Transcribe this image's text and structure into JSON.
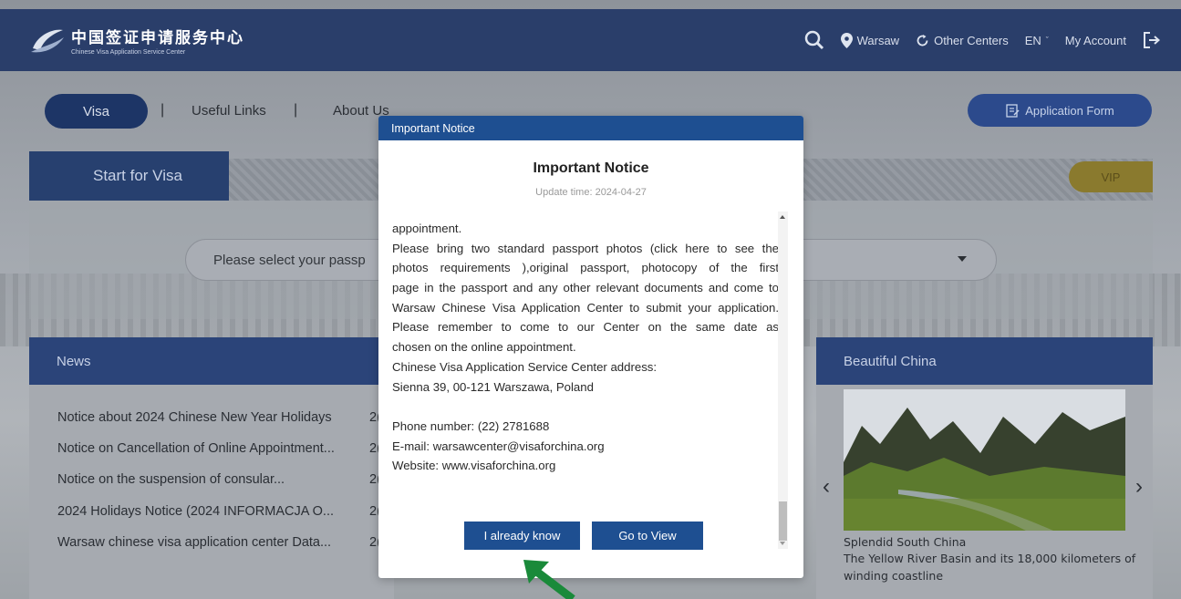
{
  "header": {
    "logo_cn": "中国签证申请服务中心",
    "logo_en": "Chinese Visa Application Service Center",
    "location": "Warsaw",
    "other_centers": "Other Centers",
    "language": "EN",
    "my_account": "My Account"
  },
  "nav": {
    "visa": "Visa",
    "useful_links": "Useful Links",
    "about_us": "About Us",
    "separator": "|",
    "application_form": "Application Form"
  },
  "start": {
    "title": "Start for Visa",
    "vip": "VIP",
    "passport_placeholder": "Please select your passp"
  },
  "news": {
    "title": "News",
    "items": [
      {
        "title": "Notice about 2024 Chinese New Year Holidays",
        "date": "2("
      },
      {
        "title": "Notice on Cancellation of Online Appointment...",
        "date": "2("
      },
      {
        "title": "Notice on the suspension of consular...",
        "date": "2("
      },
      {
        "title": "2024 Holidays Notice (2024 INFORMACJA O...",
        "date": "2("
      },
      {
        "title": "Warsaw chinese visa application center Data...",
        "date": "2("
      }
    ]
  },
  "beautiful_china": {
    "title": "Beautiful China",
    "caption_title": "Splendid South China",
    "caption_line1": "The Yellow River Basin and its 18,000 kilometers of",
    "caption_line2": "winding coastline"
  },
  "modal": {
    "header": "Important Notice",
    "title": "Important Notice",
    "update_time": "Update time: 2024-04-27",
    "lines": [
      "appointment.",
      "Please bring two standard passport photos (click here to see the",
      "photos requirements ),original passport, photocopy of the first",
      "page in the passport and any other relevant documents and come to",
      "Warsaw Chinese Visa Application Center to submit your application.",
      "Please remember to come to our Center on the same date as",
      "chosen on the online appointment.",
      "Chinese Visa Application Service Center address:",
      "Sienna 39, 00-121 Warszawa, Poland",
      "",
      "Phone number: (22) 2781688",
      "E-mail: warsawcenter@visaforchina.org",
      "Website: www.visaforchina.org"
    ],
    "btn_know": "I already know",
    "btn_view": "Go to View"
  },
  "colors": {
    "modal_header": "#1e4f91",
    "button": "#1e4f91",
    "pointer_arrow": "#1a8a3a"
  }
}
